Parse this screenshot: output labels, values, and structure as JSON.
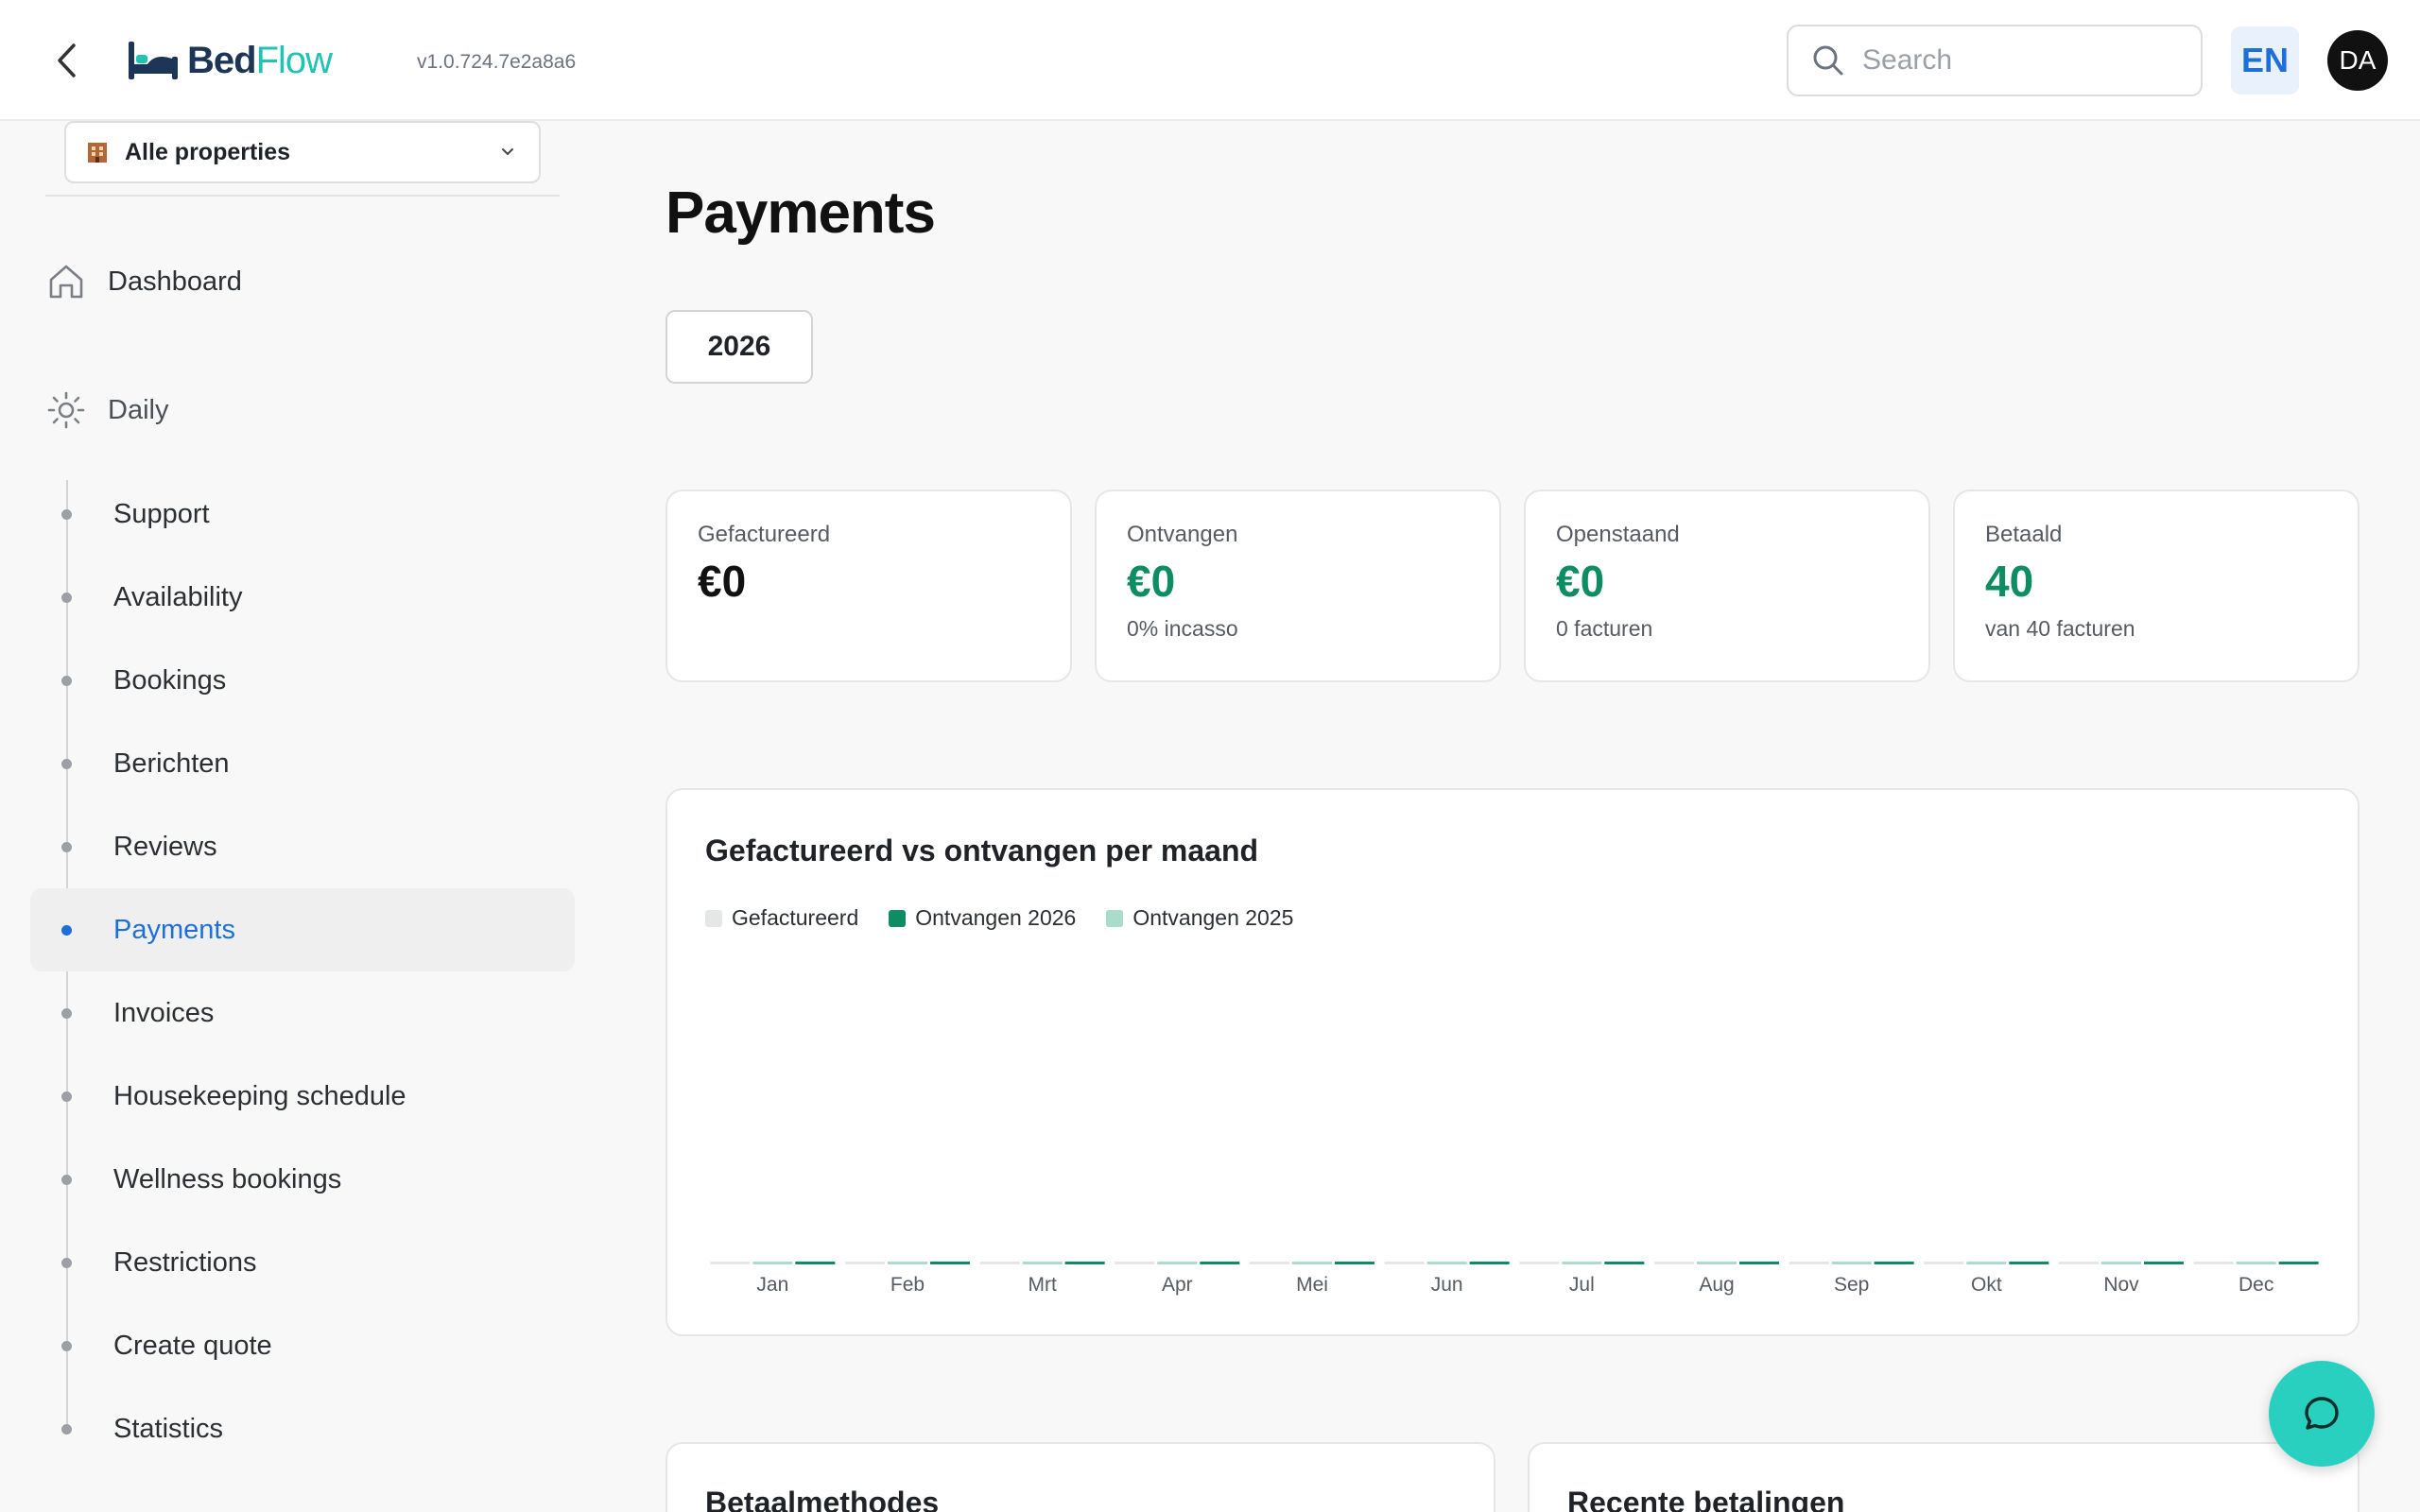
{
  "header": {
    "back_label": "Back",
    "logo_part1": "Bed",
    "logo_part2": "Flow",
    "version": "v1.0.724.7e2a8a6",
    "search_placeholder": "Search",
    "language": "EN",
    "user_initials": "DA"
  },
  "sidebar": {
    "property_select": "Alle properties",
    "dashboard": "Dashboard",
    "section": "Daily",
    "items": [
      {
        "label": "Support",
        "active": false
      },
      {
        "label": "Availability",
        "active": false
      },
      {
        "label": "Bookings",
        "active": false
      },
      {
        "label": "Berichten",
        "active": false
      },
      {
        "label": "Reviews",
        "active": false
      },
      {
        "label": "Payments",
        "active": true
      },
      {
        "label": "Invoices",
        "active": false
      },
      {
        "label": "Housekeeping schedule",
        "active": false
      },
      {
        "label": "Wellness bookings",
        "active": false
      },
      {
        "label": "Restrictions",
        "active": false
      },
      {
        "label": "Create quote",
        "active": false
      },
      {
        "label": "Statistics",
        "active": false
      }
    ]
  },
  "main": {
    "title": "Payments",
    "year": "2026",
    "cards": [
      {
        "label": "Gefactureerd",
        "value": "€0",
        "sub": "",
        "green": false
      },
      {
        "label": "Ontvangen",
        "value": "€0",
        "sub": "0% incasso",
        "green": true
      },
      {
        "label": "Openstaand",
        "value": "€0",
        "sub": "0 facturen",
        "green": true
      },
      {
        "label": "Betaald",
        "value": "40",
        "sub": "van 40 facturen",
        "green": true
      }
    ],
    "chart_title": "Gefactureerd vs ontvangen per maand",
    "bottom_left_title": "Betaalmethodes",
    "bottom_right_title": "Recente betalingen"
  },
  "colors": {
    "accent": "#1e6fd9",
    "green": "#0e8c62",
    "teal": "#22c3b4",
    "invoiced": "#e5e7e6",
    "received_2026": "#0e8c62",
    "received_2025": "#a9dccb"
  },
  "chart_data": {
    "type": "bar",
    "categories": [
      "Jan",
      "Feb",
      "Mrt",
      "Apr",
      "Mei",
      "Jun",
      "Jul",
      "Aug",
      "Sep",
      "Okt",
      "Nov",
      "Dec"
    ],
    "series": [
      {
        "name": "Gefactureerd",
        "color": "#e5e7e6",
        "values": [
          0,
          0,
          0,
          0,
          0,
          0,
          0,
          0,
          0,
          0,
          0,
          0
        ]
      },
      {
        "name": "Ontvangen 2026",
        "color": "#0e8c62",
        "values": [
          0,
          0,
          0,
          0,
          0,
          0,
          0,
          0,
          0,
          0,
          0,
          0
        ]
      },
      {
        "name": "Ontvangen 2025",
        "color": "#a9dccb",
        "values": [
          0,
          0,
          0,
          0,
          0,
          0,
          0,
          0,
          0,
          0,
          0,
          0
        ]
      }
    ],
    "title": "Gefactureerd vs ontvangen per maand",
    "legend_position": "top-left",
    "grid": false
  }
}
